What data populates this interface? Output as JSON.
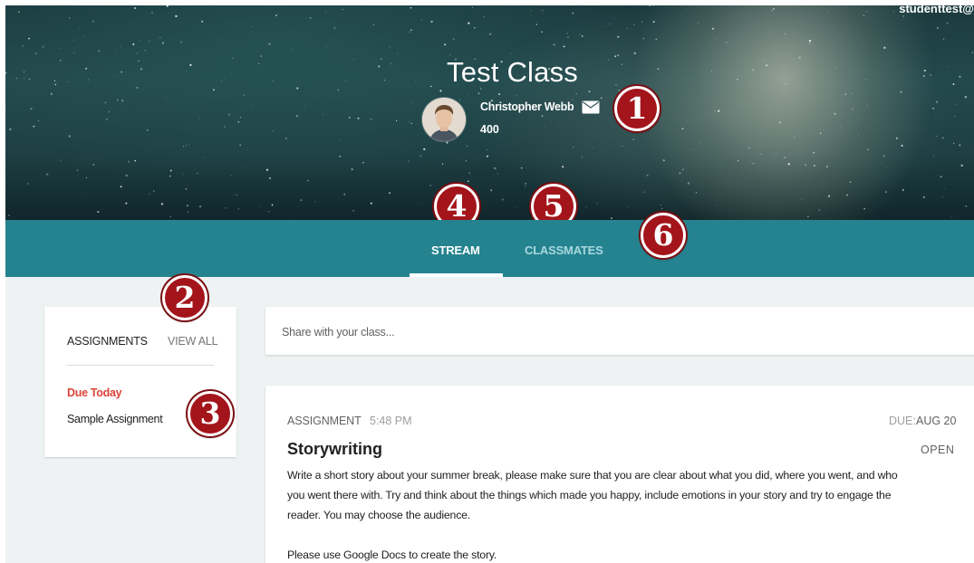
{
  "header": {
    "user_email": "studenttest@",
    "class_title": "Test Class",
    "teacher_name": "Christopher Webb",
    "section": "400"
  },
  "tabs": [
    {
      "label": "STREAM",
      "active": true
    },
    {
      "label": "CLASSMATES",
      "active": false
    }
  ],
  "badges": [
    "1",
    "2",
    "3",
    "4",
    "5",
    "6"
  ],
  "sidebar": {
    "heading": "ASSIGNMENTS",
    "view_all": "VIEW ALL",
    "due_today": "Due Today",
    "items": [
      "Sample Assignment"
    ]
  },
  "share": {
    "placeholder": "Share with your class..."
  },
  "post": {
    "type": "ASSIGNMENT",
    "time": "5:48 PM",
    "due_label": "DUE:",
    "due_date": "AUG 20",
    "title": "Storywriting",
    "status": "OPEN",
    "body": [
      "Write a short story about your summer break, please make sure that you are clear about what you did, where you went, and who you went there with. Try and think about the things which made you happy, include emotions in your story and try to engage the reader. You may choose the audience.",
      "Please use Google Docs to create the story."
    ]
  },
  "colors": {
    "tab_bar": "#24838f",
    "badge": "#a3151b",
    "due_today": "#db4437",
    "background": "#eef2f3"
  }
}
